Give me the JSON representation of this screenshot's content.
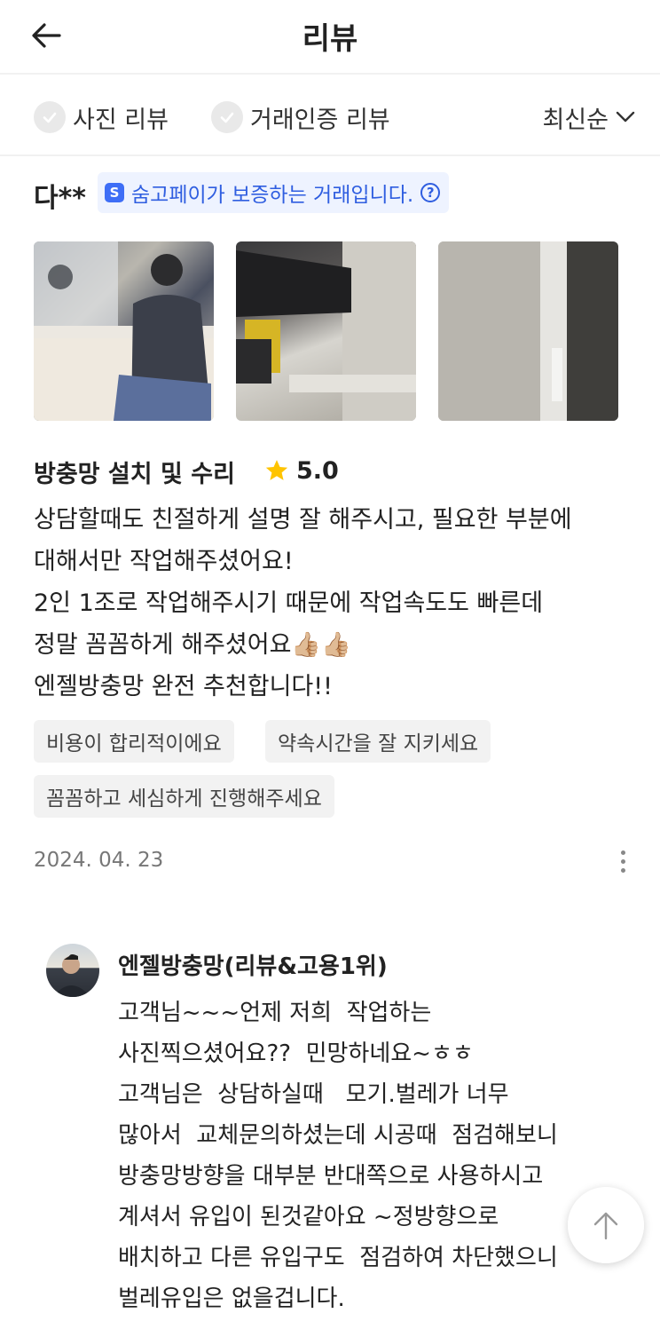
{
  "header": {
    "title": "리뷰",
    "back_icon": "arrow-left-icon"
  },
  "filters": {
    "photo_review": "사진 리뷰",
    "verified_review": "거래인증 리뷰",
    "sort": "최신순"
  },
  "review": {
    "reviewer": "다**",
    "pay_badge": "숨고페이가 보증하는 거래입니다.",
    "pay_logo": "S",
    "service": "방충망 설치 및 수리",
    "rating": "5.0",
    "body_lines": [
      "상담할때도 친절하게 설명 잘 해주시고, 필요한 부분에",
      "대해서만 작업해주셨어요!",
      "2인 1조로 작업해주시기 때문에 작업속도도 빠른데",
      "정말 꼼꼼하게 해주셨어요👍🏼👍🏼",
      "엔젤방충망 완전 추천합니다!!"
    ],
    "tags": [
      "비용이 합리적이에요",
      "약속시간을 잘 지키세요",
      "꼼꼼하고 세심하게 진행해주세요"
    ],
    "date": "2024. 04. 23"
  },
  "reply": {
    "name": "엔젤방충망(리뷰&고용1위)",
    "lines": [
      "고객님~~~언제 저희  작업하는",
      "사진찍으셨어요??  민망하네요~ㅎㅎ",
      "고객님은  상담하실때   모기.벌레가 너무",
      "많아서  교체문의하셨는데 시공때  점검해보니",
      "방충망방향을 대부분 반대쪽으로 사용하시고",
      "계셔서 유입이 된것같아요 ~정방향으로",
      "배치하고 다른 유입구도  점검하여 차단했으니",
      "벌레유입은 없을겁니다."
    ]
  },
  "colors": {
    "accent_blue": "#2f5ee0",
    "star": "#ffc400",
    "tag_bg": "#f2f2f2"
  }
}
